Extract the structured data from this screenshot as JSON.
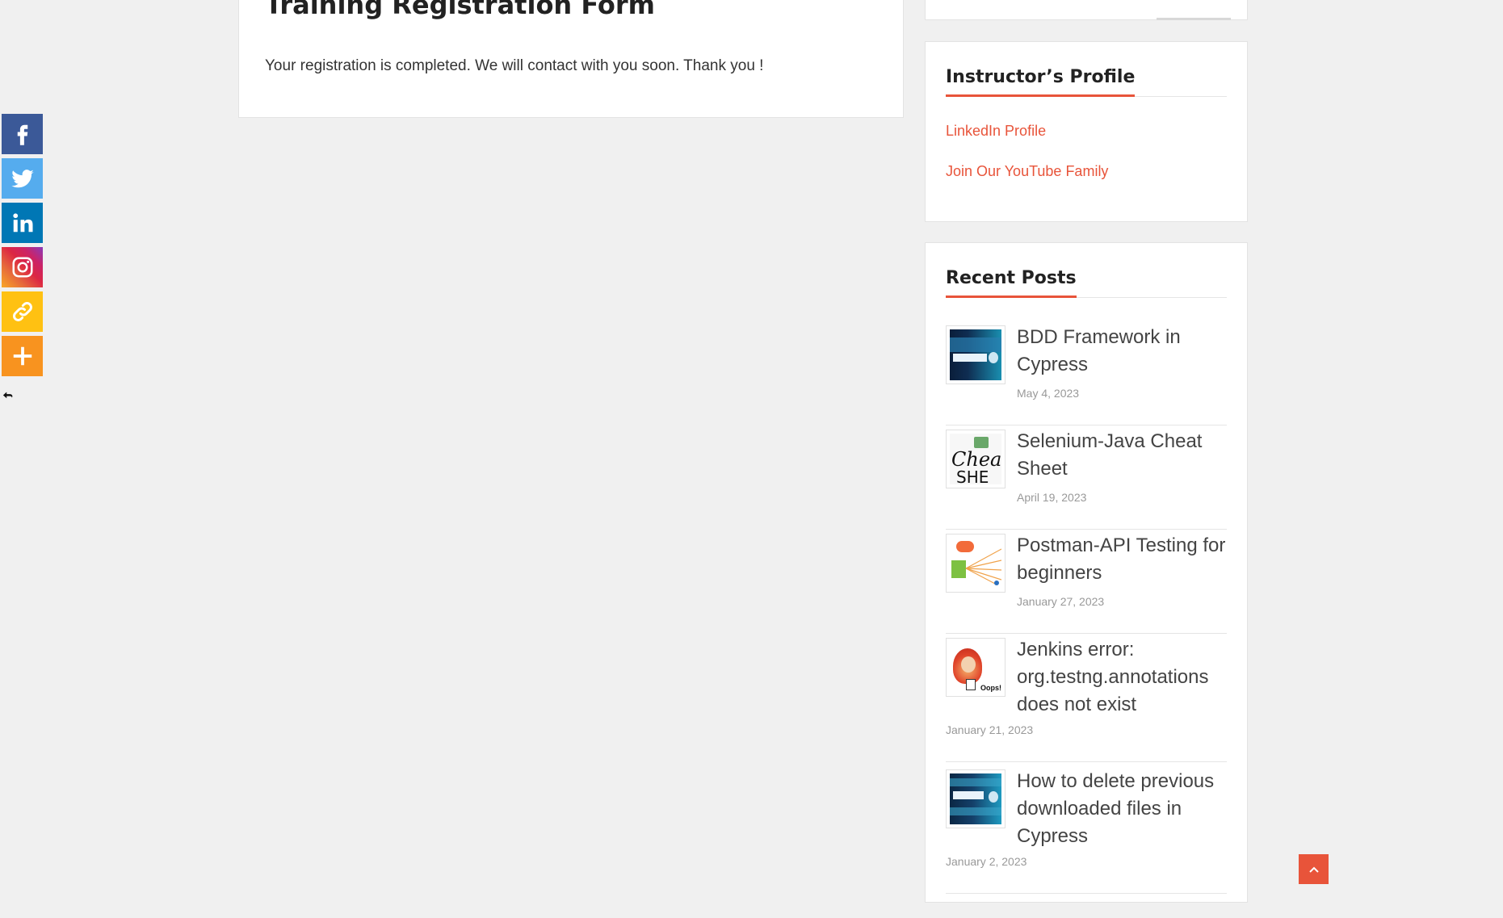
{
  "share": {
    "buttons": [
      {
        "name": "Facebook",
        "color": "#3b5998",
        "icon": "facebook-icon"
      },
      {
        "name": "Twitter",
        "color": "#55acee",
        "icon": "twitter-icon"
      },
      {
        "name": "LinkedIn",
        "color": "#0077b5",
        "icon": "linkedin-icon"
      },
      {
        "name": "Instagram",
        "color": "#d6249f",
        "icon": "instagram-icon"
      },
      {
        "name": "Copy Link",
        "color": "#ffc112",
        "icon": "link-icon"
      },
      {
        "name": "More",
        "color": "#f8931f",
        "icon": "plus-icon"
      }
    ]
  },
  "main": {
    "title": "Training Registration Form",
    "message": "Your registration is completed. We will contact with you soon. Thank you !"
  },
  "instructor": {
    "title": "Instructor’s Profile",
    "links": [
      "LinkedIn Profile",
      "Join Our YouTube Family"
    ]
  },
  "recent": {
    "title": "Recent Posts",
    "posts": [
      {
        "title": "BDD Framework in Cypress",
        "date": "May 4, 2023",
        "thumb": "cypress-bdd-thumbnail"
      },
      {
        "title": "Selenium-Java Cheat Sheet",
        "date": "April 19, 2023",
        "thumb": "cheat-sheet-thumbnail"
      },
      {
        "title": "Postman-API Testing for beginners",
        "date": "January 27, 2023",
        "thumb": "postman-thumbnail"
      },
      {
        "title": "Jenkins error: org.testng.annotations does not exist",
        "date": "January 21, 2023",
        "thumb": "jenkins-oops-thumbnail"
      },
      {
        "title": "How to delete previous downloaded files in Cypress",
        "date": "January 2, 2023",
        "thumb": "cypress-delete-thumbnail"
      }
    ]
  },
  "colors": {
    "accent": "#e8543a",
    "background": "#f0f0f0"
  }
}
